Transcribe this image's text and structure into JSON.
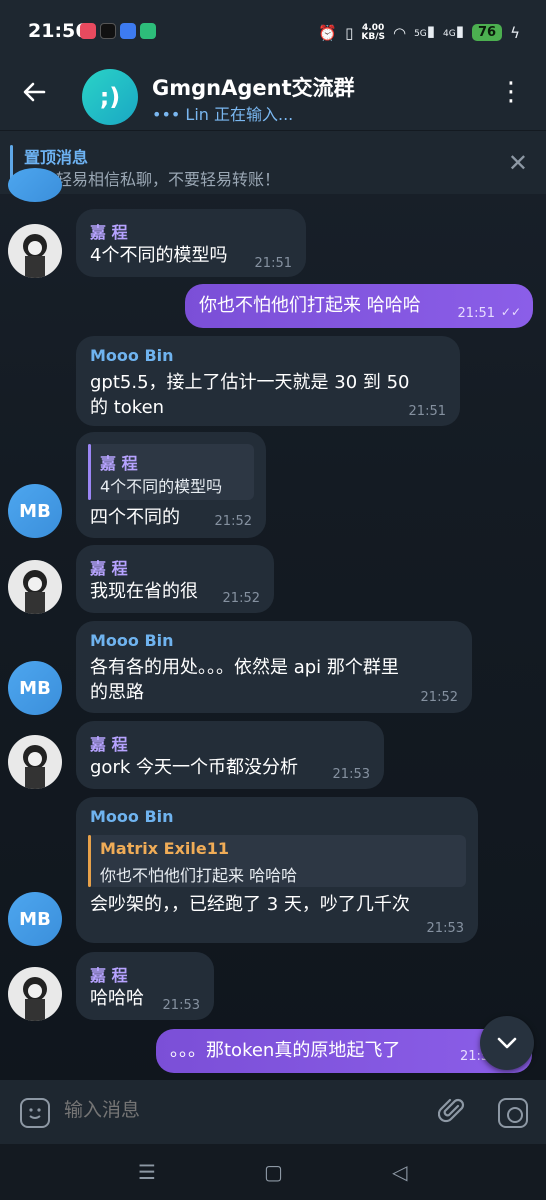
{
  "status_bar": {
    "time": "21:56",
    "speed_value": "4.00",
    "speed_unit": "KB/S",
    "net1": "5G",
    "net2": "4G",
    "battery": "76"
  },
  "header": {
    "group_name": "GmgnAgent交流群",
    "typing_status": "Lin 正在输入...",
    "avatar_text": ";)"
  },
  "pinned": {
    "title": "置顶消息",
    "text": "请勿轻易相信私聊，不要轻易转账！"
  },
  "messages": [
    {
      "sender": "嘉 程",
      "text": "4个不同的模型吗",
      "time": "21:51"
    },
    {
      "text": "你也不怕他们打起来 哈哈哈",
      "time": "21:51"
    },
    {
      "sender": "Mooo Bin",
      "text1": "gpt5.5，接上了估计一天就是 30 到 50",
      "text2": "的 token",
      "time": "21:51"
    },
    {
      "reply_name": "嘉 程",
      "reply_text": "4个不同的模型吗",
      "text": "四个不同的",
      "time": "21:52"
    },
    {
      "sender": "嘉 程",
      "text": "我现在省的很",
      "time": "21:52"
    },
    {
      "sender": "Mooo Bin",
      "text1": "各有各的用处。。。依然是 api 那个群里",
      "text2": "的思路",
      "time": "21:52"
    },
    {
      "sender": "嘉 程",
      "text": "gork 今天一个币都没分析",
      "time": "21:53"
    },
    {
      "sender": "Mooo Bin",
      "reply_name": "Matrix Exile11",
      "reply_text": "你也不怕他们打起来 哈哈哈",
      "text": "会吵架的，，已经跑了 3 天，吵了几千次",
      "time": "21:53"
    },
    {
      "sender": "嘉 程",
      "text": "哈哈哈",
      "time": "21:53"
    },
    {
      "text": "。。。那token真的原地起飞了",
      "time": "21:5"
    }
  ],
  "avatars": {
    "mb": "MB"
  },
  "input": {
    "placeholder": "输入消息"
  },
  "colors": {
    "outgoing": "#7b4fd7",
    "incoming": "#232d38",
    "accent": "#6fb3ef"
  }
}
